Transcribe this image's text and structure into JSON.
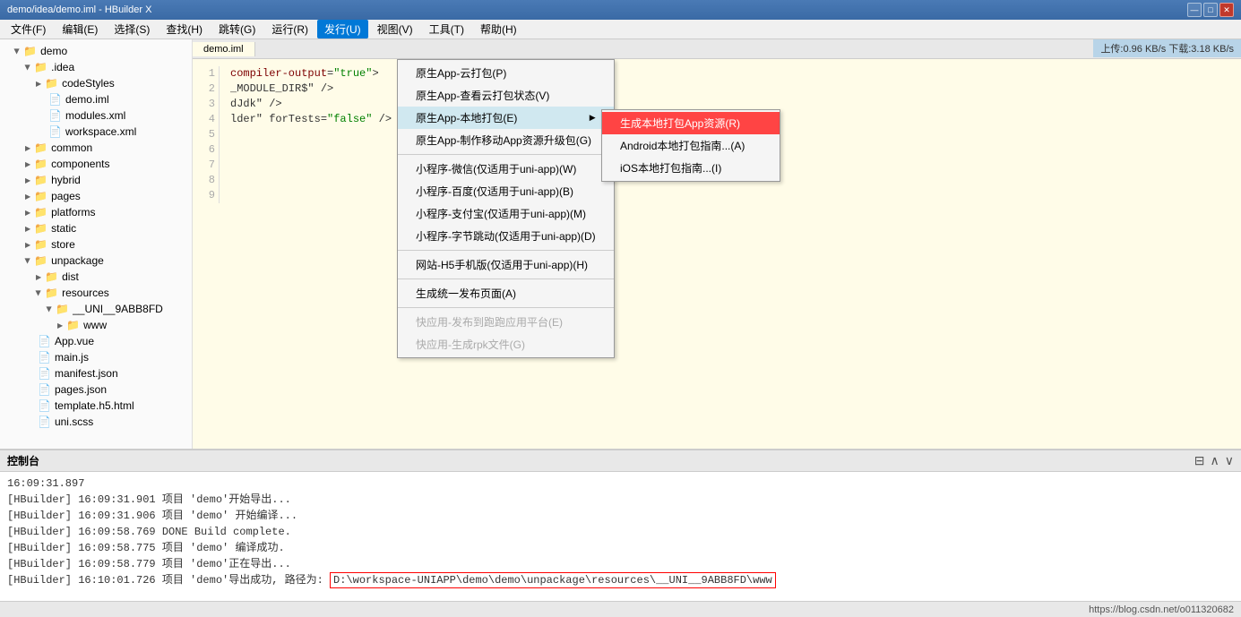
{
  "titleBar": {
    "title": "demo/idea/demo.iml - HBuilder X",
    "controls": [
      "—",
      "□",
      "✕"
    ]
  },
  "menuBar": {
    "items": [
      {
        "id": "file",
        "label": "文件(F)"
      },
      {
        "id": "edit",
        "label": "编辑(E)"
      },
      {
        "id": "select",
        "label": "选择(S)"
      },
      {
        "id": "find",
        "label": "查找(H)"
      },
      {
        "id": "jump",
        "label": "跳转(G)"
      },
      {
        "id": "run",
        "label": "运行(R)"
      },
      {
        "id": "publish",
        "label": "发行(U)",
        "active": true
      },
      {
        "id": "view",
        "label": "视图(V)"
      },
      {
        "id": "tools",
        "label": "工具(T)"
      },
      {
        "id": "help",
        "label": "帮助(H)"
      }
    ]
  },
  "publishMenu": {
    "items": [
      {
        "id": "native-app-cloud",
        "label": "原生App-云打包(P)",
        "shortcut": ""
      },
      {
        "id": "native-app-cloud-status",
        "label": "原生App-查看云打包状态(V)",
        "shortcut": ""
      },
      {
        "id": "native-app-local",
        "label": "原生App-本地打包(E)",
        "hasSubmenu": true
      },
      {
        "id": "native-app-update",
        "label": "原生App-制作移动App资源升级包(G)",
        "shortcut": ""
      },
      {
        "id": "sep1",
        "separator": true
      },
      {
        "id": "mp-weixin",
        "label": "小程序-微信(仅适用于uni-app)(W)",
        "shortcut": ""
      },
      {
        "id": "mp-baidu",
        "label": "小程序-百度(仅适用于uni-app)(B)",
        "shortcut": ""
      },
      {
        "id": "mp-alipay",
        "label": "小程序-支付宝(仅适用于uni-app)(M)",
        "shortcut": ""
      },
      {
        "id": "mp-toutiao",
        "label": "小程序-字节跳动(仅适用于uni-app)(D)",
        "shortcut": ""
      },
      {
        "id": "sep2",
        "separator": true
      },
      {
        "id": "h5",
        "label": "网站-H5手机版(仅适用于uni-app)(H)",
        "shortcut": ""
      },
      {
        "id": "sep3",
        "separator": true
      },
      {
        "id": "gen-page",
        "label": "生成统一发布页面(A)",
        "shortcut": ""
      },
      {
        "id": "sep4",
        "separator": true
      },
      {
        "id": "quick-pub",
        "label": "快应用-发布到跑跑应用平台(E)",
        "disabled": true
      },
      {
        "id": "quick-rpk",
        "label": "快应用-生成rpk文件(G)",
        "disabled": true
      }
    ]
  },
  "localPackageSubmenu": {
    "items": [
      {
        "id": "gen-resources",
        "label": "生成本地打包App资源(R)",
        "highlighted": true
      },
      {
        "id": "android-guide",
        "label": "Android本地打包指南...(A)",
        "shortcut": ""
      },
      {
        "id": "ios-guide",
        "label": "iOS本地打包指南...(I)",
        "shortcut": ""
      }
    ]
  },
  "sidebar": {
    "items": [
      {
        "id": "demo-root",
        "label": "demo",
        "level": 0,
        "open": true,
        "isFolder": true
      },
      {
        "id": "idea",
        "label": ".idea",
        "level": 1,
        "open": true,
        "isFolder": true
      },
      {
        "id": "codeStyles",
        "label": "codeStyles",
        "level": 2,
        "isFolder": true
      },
      {
        "id": "demo-iml",
        "label": "demo.iml",
        "level": 2,
        "isFile": true,
        "active": true
      },
      {
        "id": "modules-xml",
        "label": "modules.xml",
        "level": 2,
        "isFile": true
      },
      {
        "id": "workspace-xml",
        "label": "workspace.xml",
        "level": 2,
        "isFile": true
      },
      {
        "id": "common",
        "label": "common",
        "level": 1,
        "isFolder": true
      },
      {
        "id": "components",
        "label": "components",
        "level": 1,
        "isFolder": true
      },
      {
        "id": "hybrid",
        "label": "hybrid",
        "level": 1,
        "isFolder": true
      },
      {
        "id": "pages",
        "label": "pages",
        "level": 1,
        "isFolder": true
      },
      {
        "id": "platforms",
        "label": "platforms",
        "level": 1,
        "isFolder": true
      },
      {
        "id": "static",
        "label": "static",
        "level": 1,
        "isFolder": true
      },
      {
        "id": "store",
        "label": "store",
        "level": 1,
        "isFolder": true
      },
      {
        "id": "unpackage",
        "label": "unpackage",
        "level": 1,
        "open": true,
        "isFolder": true
      },
      {
        "id": "dist",
        "label": "dist",
        "level": 2,
        "isFolder": true
      },
      {
        "id": "resources",
        "label": "resources",
        "level": 2,
        "open": true,
        "isFolder": true
      },
      {
        "id": "uni9abb8fd",
        "label": "__UNI__9ABB8FD",
        "level": 3,
        "open": true,
        "isFolder": true
      },
      {
        "id": "www",
        "label": "www",
        "level": 4,
        "isFolder": true
      },
      {
        "id": "app-vue",
        "label": "App.vue",
        "level": 1,
        "isFile": true
      },
      {
        "id": "main-js",
        "label": "main.js",
        "level": 1,
        "isFile": true
      },
      {
        "id": "manifest-json",
        "label": "manifest.json",
        "level": 1,
        "isFile": true
      },
      {
        "id": "pages-json",
        "label": "pages.json",
        "level": 1,
        "isFile": true
      },
      {
        "id": "template-h5",
        "label": "template.h5.html",
        "level": 1,
        "isFile": true
      },
      {
        "id": "uni-scss",
        "label": "uni.scss",
        "level": 1,
        "isFile": true
      }
    ]
  },
  "editor": {
    "tabs": [
      {
        "label": "demo.iml",
        "active": true
      }
    ],
    "lineNumbers": [
      "1",
      "2",
      "3",
      "4",
      "5",
      "6",
      "7",
      "8",
      "9"
    ],
    "lines": [
      "",
      "",
      "  compiler-output=\"true\">",
      "",
      "    _MODULE_DIR$\" />",
      "    dJdk\" />",
      "    lder\" forTests=\"false\" />",
      "",
      ""
    ]
  },
  "statusTop": {
    "label": "上传:0.96 KB/s  下载:3.18 KB/s"
  },
  "console": {
    "title": "控制台",
    "timestamp": "16:09:31.897",
    "lines": [
      {
        "text": "[HBuilder] 16:09:31.901 项目 'demo'开始导出..."
      },
      {
        "text": "[HBuilder] 16:09:31.906 项目 'demo' 开始编译..."
      },
      {
        "text": "[HBuilder] 16:09:58.769 DONE  Build complete."
      },
      {
        "text": "[HBuilder] 16:09:58.775 项目 'demo' 编译成功."
      },
      {
        "text": "[HBuilder] 16:09:58.779 项目 'demo'正在导出..."
      },
      {
        "text": "[HBuilder] 16:10:01.726 项目 'demo'导出成功, 路径为:",
        "hasLink": true,
        "linkText": "D:\\workspace-UNIAPP\\demo\\demo\\unpackage\\resources\\__UNI__9ABB8FD\\www"
      }
    ]
  },
  "bottomStatus": {
    "label": "https://blog.csdn.net/o011320682"
  }
}
